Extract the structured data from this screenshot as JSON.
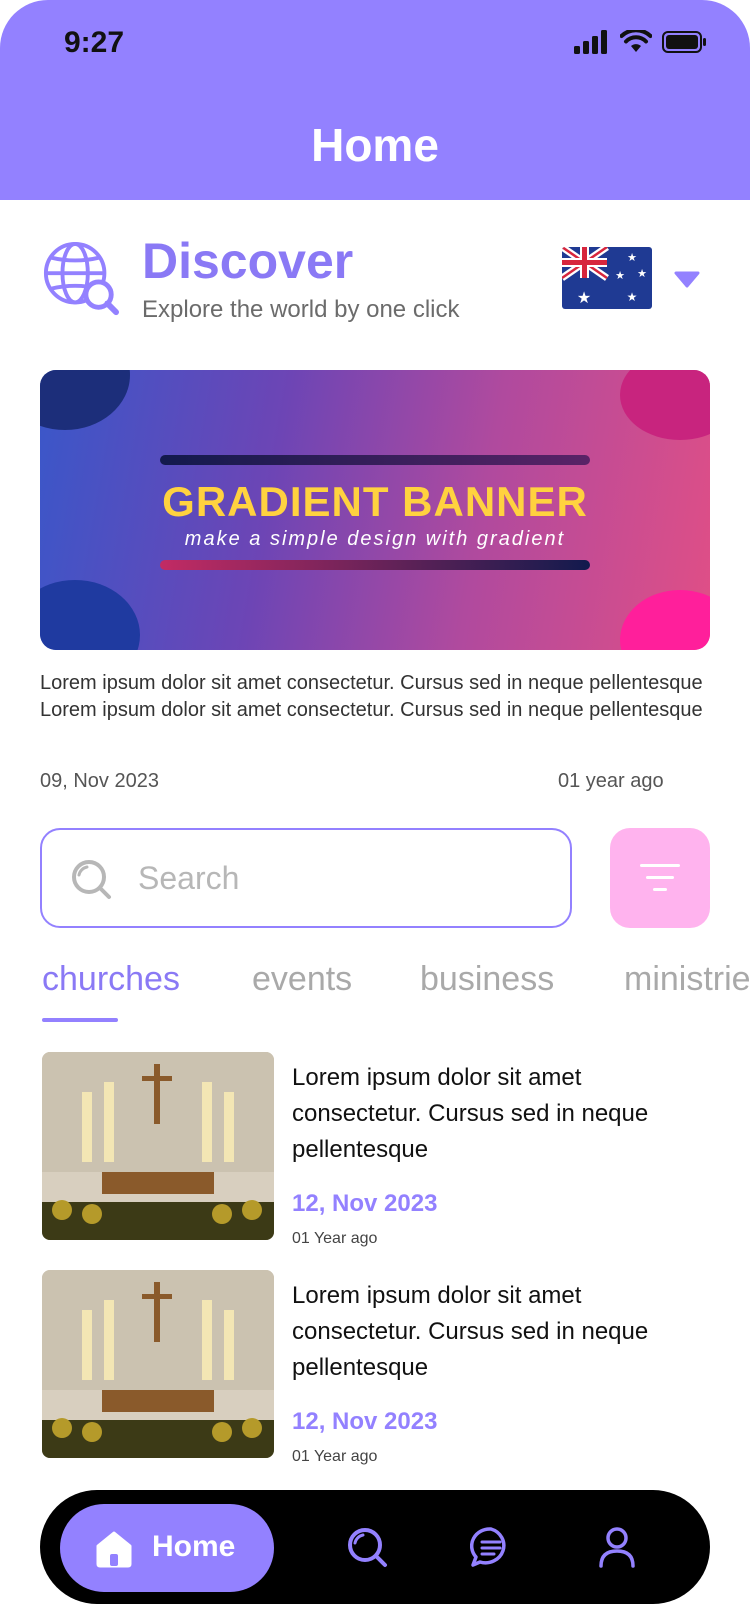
{
  "status_bar": {
    "time": "9:27"
  },
  "header": {
    "title": "Home"
  },
  "discover": {
    "title": "Discover",
    "subtitle": "Explore the world by one click",
    "country_flag": "australia-flag-icon"
  },
  "banner": {
    "title": "GRADIENT BANNER",
    "subtitle": "make a simple design with gradient"
  },
  "intro": {
    "text": "Lorem ipsum dolor sit amet consectetur. Cursus sed in neque pellentesque Lorem ipsum dolor sit amet consectetur. Cursus sed in neque pellentesque",
    "date": "09, Nov 2023",
    "ago": "01 year ago"
  },
  "search": {
    "placeholder": "Search",
    "value": ""
  },
  "tabs": [
    {
      "label": "churches",
      "active": true
    },
    {
      "label": "events",
      "active": false
    },
    {
      "label": "business",
      "active": false
    },
    {
      "label": "ministries",
      "active": false
    }
  ],
  "items": [
    {
      "title": "Lorem ipsum dolor sit amet consectetur. Cursus sed in neque pellentesque",
      "date": "12, Nov 2023",
      "ago": "01 Year ago"
    },
    {
      "title": "Lorem ipsum dolor sit amet consectetur. Cursus sed in neque pellentesque",
      "date": "12, Nov 2023",
      "ago": "01 Year ago"
    }
  ],
  "nav": {
    "home_label": "Home",
    "icons": [
      "home-icon",
      "search-icon",
      "chat-icon",
      "profile-icon"
    ]
  },
  "colors": {
    "primary": "#9381FF",
    "accent_pink": "#FFB3EE",
    "banner_title": "#FFD23F",
    "nav_bg": "#000000"
  }
}
